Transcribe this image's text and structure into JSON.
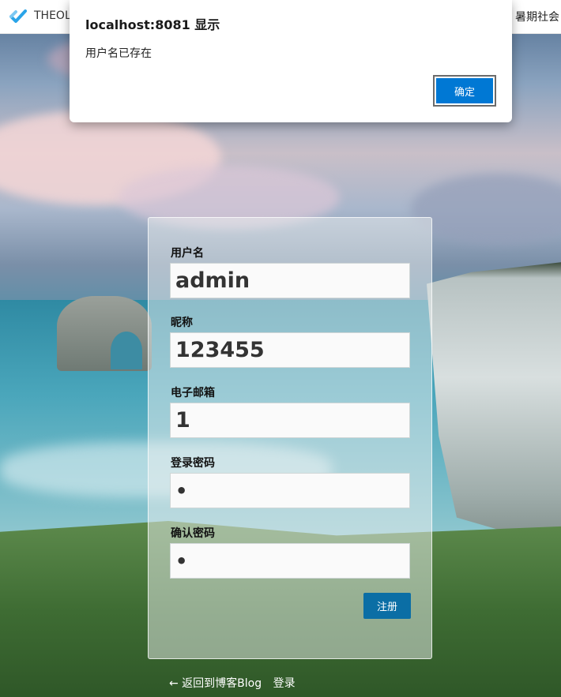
{
  "browser": {
    "site_title": "THEOL",
    "nav_right": "暑期社会",
    "logo_icon": "checkmark-logo-icon"
  },
  "dialog": {
    "title": "localhost:8081 显示",
    "message": "用户名已存在",
    "ok_label": "确定",
    "button_color": "#0078d4"
  },
  "form": {
    "fields": [
      {
        "label": "用户名",
        "value": "admin"
      },
      {
        "label": "昵称",
        "value": "123455"
      },
      {
        "label": "电子邮箱",
        "value": "1"
      },
      {
        "label": "登录密码",
        "value": "•"
      },
      {
        "label": "确认密码",
        "value": "•"
      }
    ],
    "submit_label": "注册",
    "submit_color": "#0b6ea5"
  },
  "footer": {
    "back_link": "← 返回到博客Blog",
    "login_link": "登录"
  }
}
